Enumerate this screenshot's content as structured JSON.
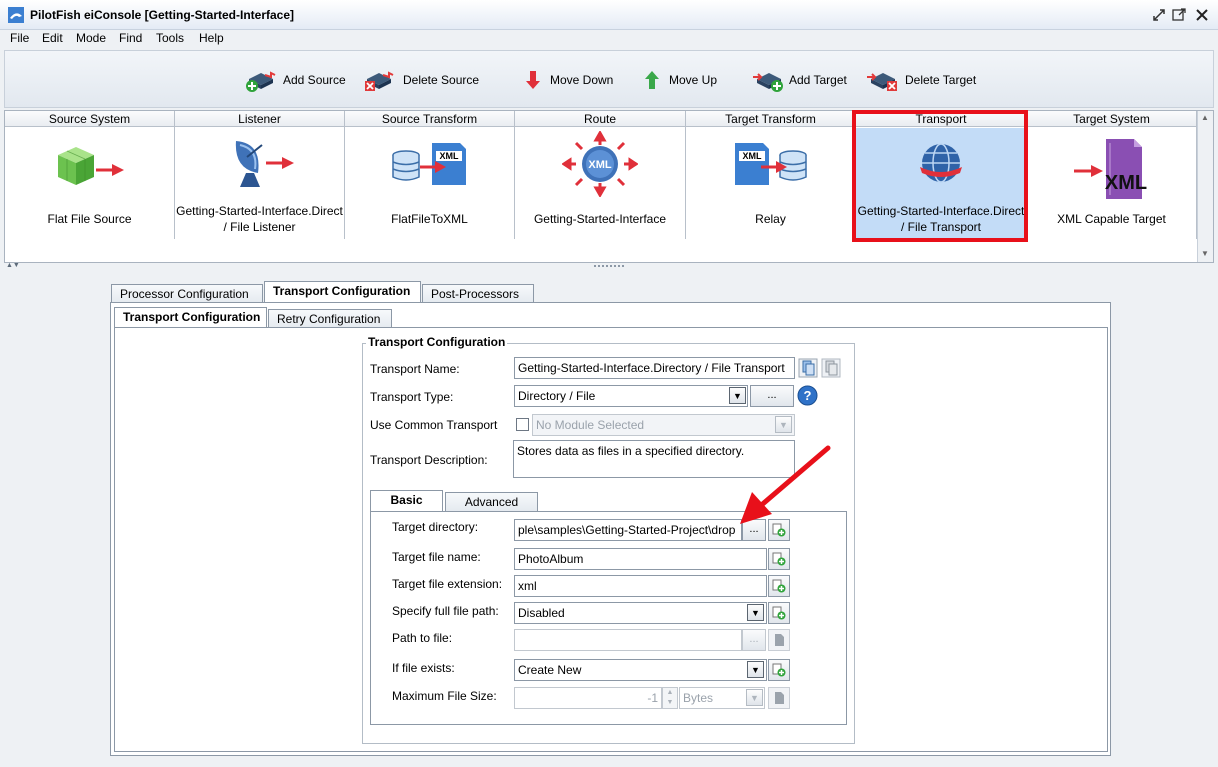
{
  "window": {
    "title": "PilotFish eiConsole [Getting-Started-Interface]"
  },
  "menu": [
    {
      "label": "File"
    },
    {
      "label": "Edit"
    },
    {
      "label": "Mode"
    },
    {
      "label": "Find"
    },
    {
      "label": "Tools"
    },
    {
      "label": "Help"
    }
  ],
  "toolbar": {
    "add_source": "Add Source",
    "delete_source": "Delete Source",
    "move_down": "Move Down",
    "move_up": "Move Up",
    "add_target": "Add Target",
    "delete_target": "Delete Target"
  },
  "stages": [
    {
      "header": "Source System",
      "label": "Flat File Source",
      "icon": "cube-arrow-icon"
    },
    {
      "header": "Listener",
      "label": "Getting-Started-Interface.Direct / File Listener",
      "icon": "satellite-dish-icon"
    },
    {
      "header": "Source Transform",
      "label": "FlatFileToXML",
      "icon": "db-to-xml-icon"
    },
    {
      "header": "Route",
      "label": "Getting-Started-Interface",
      "icon": "xml-route-icon"
    },
    {
      "header": "Target Transform",
      "label": "Relay",
      "icon": "xml-to-db-icon"
    },
    {
      "header": "Transport",
      "label": "Getting-Started-Interface.Direct / File Transport",
      "icon": "globe-icon",
      "selected": true
    },
    {
      "header": "Target System",
      "label": "XML Capable Target",
      "icon": "xml-document-icon"
    }
  ],
  "tabs_outer": {
    "processor": "Processor Configuration",
    "transport": "Transport Configuration",
    "post": "Post-Processors"
  },
  "tabs_inner": {
    "transport": "Transport Configuration",
    "retry": "Retry Configuration"
  },
  "transport_config": {
    "group_title": "Transport Configuration",
    "name_label": "Transport Name:",
    "name_value": "Getting-Started-Interface.Directory / File Transport",
    "type_label": "Transport Type:",
    "type_value": "Directory / File",
    "type_button": "...",
    "common_label": "Use Common Transport",
    "common_value": "No Module Selected",
    "desc_label": "Transport Description:",
    "desc_value": "Stores data as files in a specified directory."
  },
  "subtabs": {
    "basic": "Basic",
    "advanced": "Advanced"
  },
  "basic": {
    "target_dir_label": "Target directory:",
    "target_dir_value": "ple\\samples\\Getting-Started-Project\\drop",
    "browse": "...",
    "file_name_label": "Target file name:",
    "file_name_value": "PhotoAlbum",
    "file_ext_label": "Target file extension:",
    "file_ext_value": "xml",
    "full_path_label": "Specify full file path:",
    "full_path_value": "Disabled",
    "path_label": "Path to file:",
    "path_value": "",
    "path_browse": "...",
    "exists_label": "If file exists:",
    "exists_value": "Create New",
    "max_size_label": "Maximum File Size:",
    "max_size_value": "-1",
    "max_size_unit": "Bytes"
  },
  "colors": {
    "highlight": "#e8101a",
    "selected_stage": "#c3dcf7"
  }
}
